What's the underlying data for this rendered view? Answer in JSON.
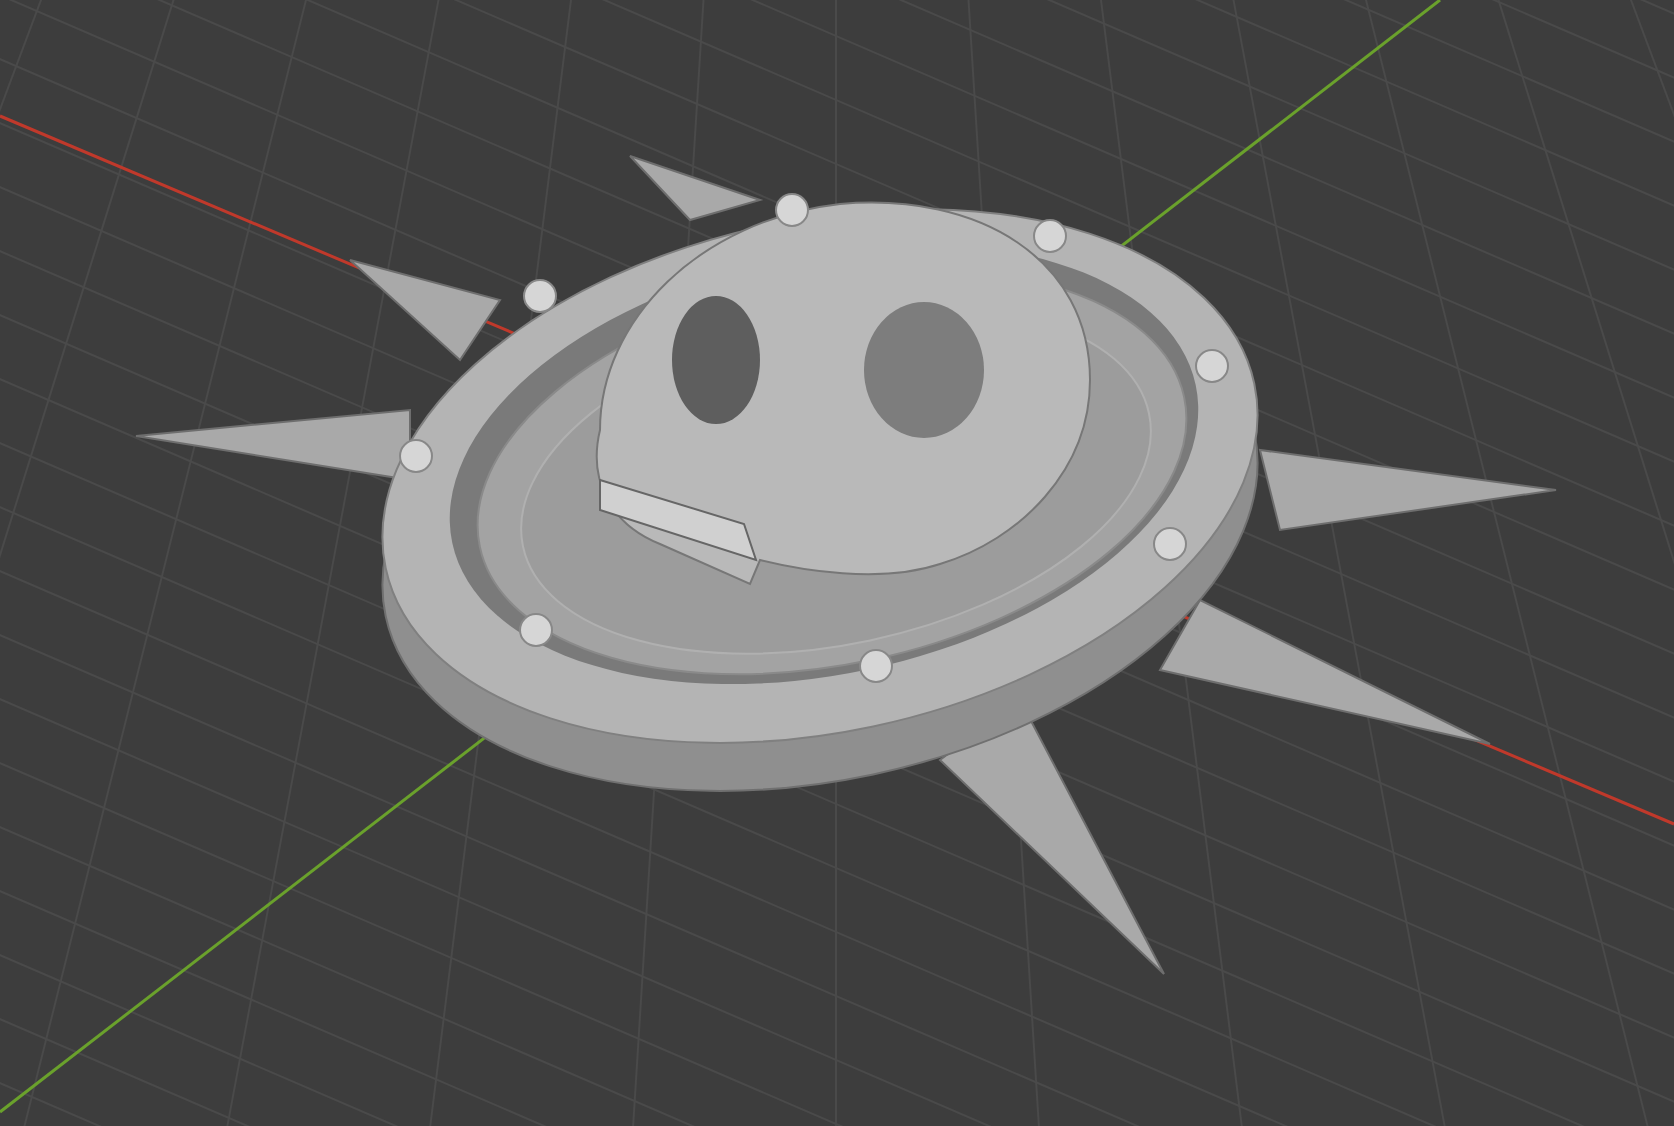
{
  "viewport": {
    "axes": [
      {
        "kind": "x",
        "color": "#c0392b"
      },
      {
        "kind": "y",
        "color": "#6aa12c"
      }
    ]
  }
}
